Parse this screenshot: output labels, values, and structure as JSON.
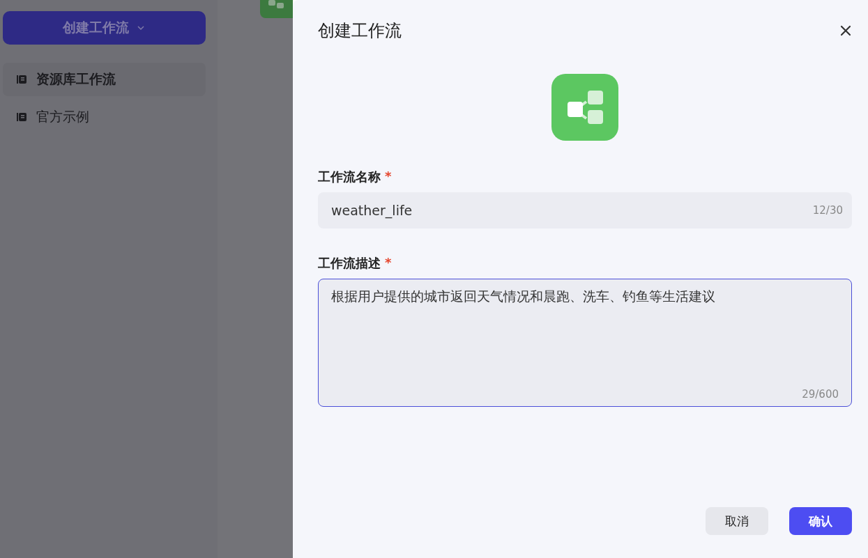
{
  "background": {
    "create_button": {
      "label": "创建工作流"
    },
    "sidebar": {
      "items": [
        {
          "label": "资源库工作流",
          "selected": true
        },
        {
          "label": "官方示例",
          "selected": false
        }
      ]
    }
  },
  "dialog": {
    "title": "创建工作流",
    "fields": [
      {
        "kind": "input",
        "label": "工作流名称",
        "required_mark": "*",
        "value": "weather_life",
        "counter": "12/30",
        "focused": false
      },
      {
        "kind": "textarea",
        "label": "工作流描述",
        "required_mark": "*",
        "value": "根据用户提供的城市返回天气情况和晨跑、洗车、钓鱼等生活建议",
        "counter": "29/600",
        "focused": true
      }
    ],
    "buttons": [
      {
        "label": "取消",
        "kind": "secondary"
      },
      {
        "label": "确认",
        "kind": "primary"
      }
    ]
  }
}
